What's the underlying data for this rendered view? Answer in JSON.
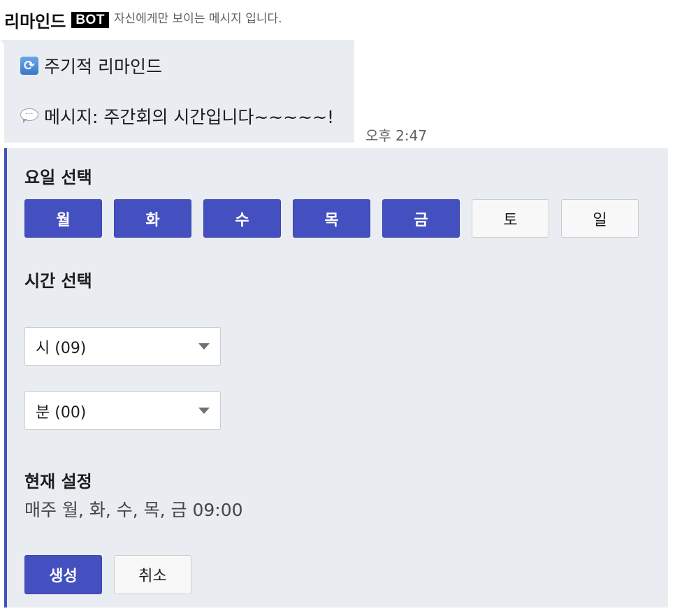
{
  "header": {
    "sender": "리마인드",
    "badge": "BOT",
    "visibility_note": "자신에게만 보이는 메시지 입니다."
  },
  "message": {
    "line1_icon": "repeat-icon",
    "line1_text": "주기적 리마인드",
    "line2_icon": "speech-bubble-icon",
    "line2_text": "메시지: 주간회의 시간입니다~~~~~!",
    "timestamp": "오후 2:47"
  },
  "panel": {
    "accent_color": "#4450c0",
    "day_section_title": "요일 선택",
    "days": [
      {
        "label": "월",
        "selected": true
      },
      {
        "label": "화",
        "selected": true
      },
      {
        "label": "수",
        "selected": true
      },
      {
        "label": "목",
        "selected": true
      },
      {
        "label": "금",
        "selected": true
      },
      {
        "label": "토",
        "selected": false
      },
      {
        "label": "일",
        "selected": false
      }
    ],
    "time_section_title": "시간 선택",
    "hour_select": "시 (09)",
    "minute_select": "분 (00)",
    "current_section_title": "현재 설정",
    "current_value": "매주 월, 화, 수, 목, 금 09:00",
    "create_label": "생성",
    "cancel_label": "취소"
  }
}
